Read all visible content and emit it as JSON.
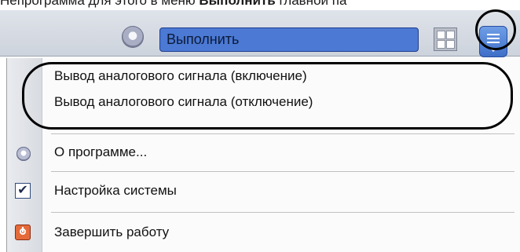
{
  "doc_text": {
    "part1": "Непрограмма для этого в меню ",
    "bold": "Выполнить",
    "part2": " главной па"
  },
  "toolbar": {
    "run_field_label": "Выполнить",
    "run_icon": "disc-icon",
    "layout_icon": "grid-layout-icon",
    "menu_icon": "menu-list-icon"
  },
  "menu": {
    "items": [
      {
        "label": "Вывод аналогового сигнала (включение)"
      },
      {
        "label": "Вывод аналогового сигнала (отключение)"
      },
      {
        "label": "О программе...",
        "icon": "disc-icon"
      },
      {
        "label": "Настройка системы",
        "icon": "checkbox-checked-icon",
        "checked": true,
        "check_glyph": "✔"
      },
      {
        "label": "Завершить работу",
        "icon": "power-exit-icon"
      }
    ]
  },
  "colors": {
    "accent_field": "#4b79d3",
    "menu_button": "#3f6fc8",
    "highlight_ring": "#000000"
  }
}
